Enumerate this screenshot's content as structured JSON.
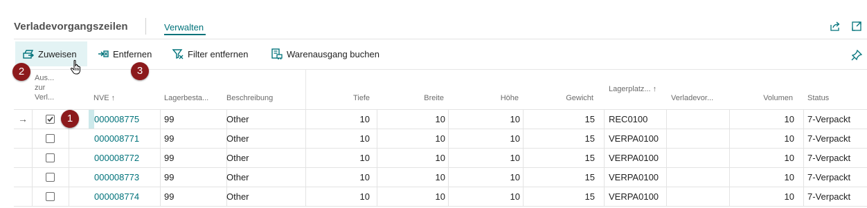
{
  "header": {
    "title": "Verladevorgangszeilen",
    "manage_tab": "Verwalten"
  },
  "toolbar": {
    "assign": "Zuweisen",
    "remove": "Entfernen",
    "clear_filter": "Filter entfernen",
    "post_shipment": "Warenausgang buchen"
  },
  "badges": [
    "1",
    "2",
    "3"
  ],
  "columns": {
    "select": "Aus... zur Verl...",
    "nve": "NVE ↑",
    "lagerbestand": "Lagerbesta...",
    "beschreibung": "Beschreibung",
    "tiefe": "Tiefe",
    "breite": "Breite",
    "hoehe": "Höhe",
    "gewicht": "Gewicht",
    "lagerplatz": "Lagerplatz... ↑",
    "verladevorgang": "Verladevor...",
    "volumen": "Volumen",
    "status": "Status"
  },
  "rows": [
    {
      "checked": true,
      "nve": "000008775",
      "lagerbestand": "99",
      "beschreibung": "Other",
      "tiefe": "10",
      "breite": "10",
      "hoehe": "10",
      "gewicht": "15",
      "lagerplatz": "REC0100",
      "verladevorgang": "",
      "volumen": "10",
      "status": "7-Verpackt"
    },
    {
      "checked": false,
      "nve": "000008771",
      "lagerbestand": "99",
      "beschreibung": "Other",
      "tiefe": "10",
      "breite": "10",
      "hoehe": "10",
      "gewicht": "15",
      "lagerplatz": "VERPA0100",
      "verladevorgang": "",
      "volumen": "10",
      "status": "7-Verpackt"
    },
    {
      "checked": false,
      "nve": "000008772",
      "lagerbestand": "99",
      "beschreibung": "Other",
      "tiefe": "10",
      "breite": "10",
      "hoehe": "10",
      "gewicht": "15",
      "lagerplatz": "VERPA0100",
      "verladevorgang": "",
      "volumen": "10",
      "status": "7-Verpackt"
    },
    {
      "checked": false,
      "nve": "000008773",
      "lagerbestand": "99",
      "beschreibung": "Other",
      "tiefe": "10",
      "breite": "10",
      "hoehe": "10",
      "gewicht": "15",
      "lagerplatz": "VERPA0100",
      "verladevorgang": "",
      "volumen": "10",
      "status": "7-Verpackt"
    },
    {
      "checked": false,
      "nve": "000008774",
      "lagerbestand": "99",
      "beschreibung": "Other",
      "tiefe": "10",
      "breite": "10",
      "hoehe": "10",
      "gewicht": "15",
      "lagerplatz": "VERPA0100",
      "verladevorgang": "",
      "volumen": "10",
      "status": "7-Verpackt"
    }
  ],
  "icons": {
    "assign": "assign-icon",
    "remove": "remove-icon",
    "clear_filter": "clear-filter-icon",
    "post_shipment": "post-shipment-icon",
    "share": "share-icon",
    "expand": "expand-icon",
    "pin": "pin-icon",
    "row_pointer": "arrow-right-icon"
  },
  "colors": {
    "accent": "#00727a",
    "badge": "#8c1a1c",
    "active_bg": "#e3f3f4"
  }
}
